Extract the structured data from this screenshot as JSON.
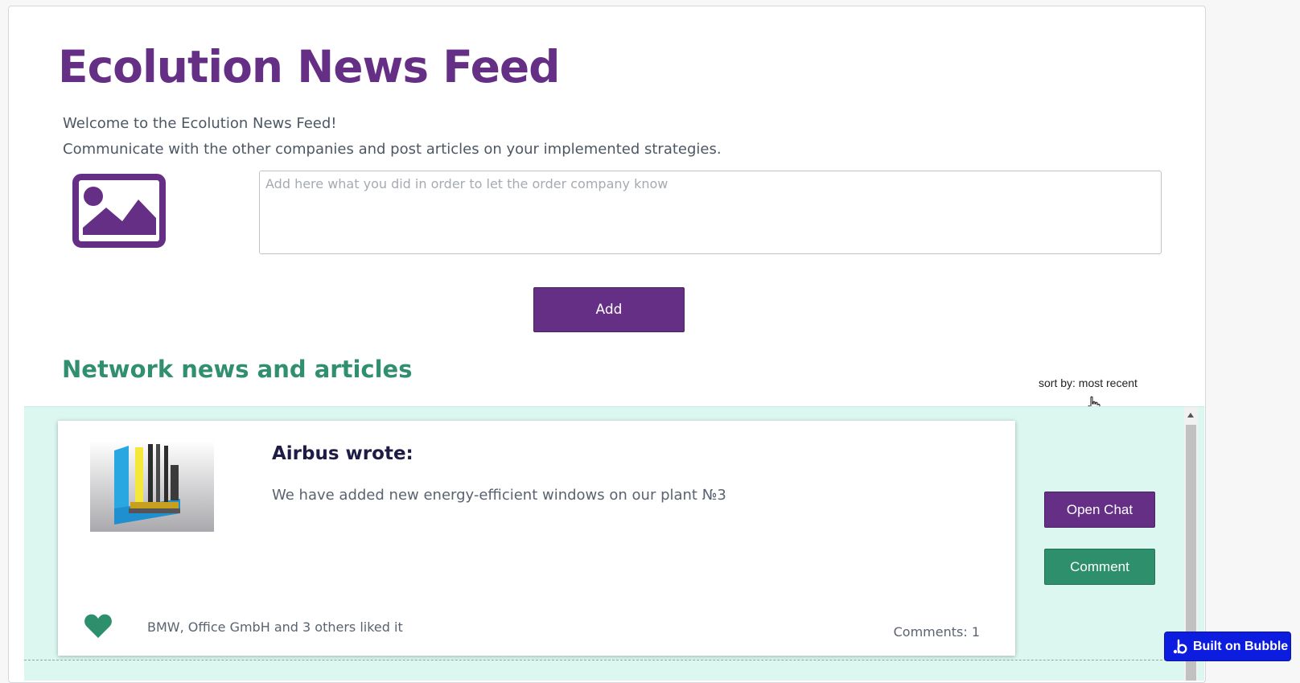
{
  "page": {
    "title": "Ecolution News Feed",
    "welcome_line1": "Welcome to the Ecolution News Feed!",
    "welcome_line2": "Communicate with the other companies and post articles on your implemented strategies."
  },
  "composer": {
    "image_upload_icon": "image-icon",
    "placeholder": "Add here what you did in order to let the order company know",
    "value": "",
    "add_label": "Add"
  },
  "feed": {
    "section_title": "Network news and articles",
    "sort_label": "sort by: most recent",
    "posts": [
      {
        "image": "window-profile-photo",
        "author_line": "Airbus wrote:",
        "message": "We have added new energy-efficient windows on our plant №3",
        "likes_text": "BMW, Office GmbH and 3 others liked it",
        "comments_text": "Comments: 1",
        "open_chat_label": "Open Chat",
        "comment_label": "Comment"
      }
    ]
  },
  "badge": {
    "label": "Built on Bubble"
  },
  "colors": {
    "brand_purple": "#652f86",
    "brand_green": "#2f8f6f",
    "feed_background": "#dbf7ef",
    "bubble_blue": "#0d1de0"
  }
}
